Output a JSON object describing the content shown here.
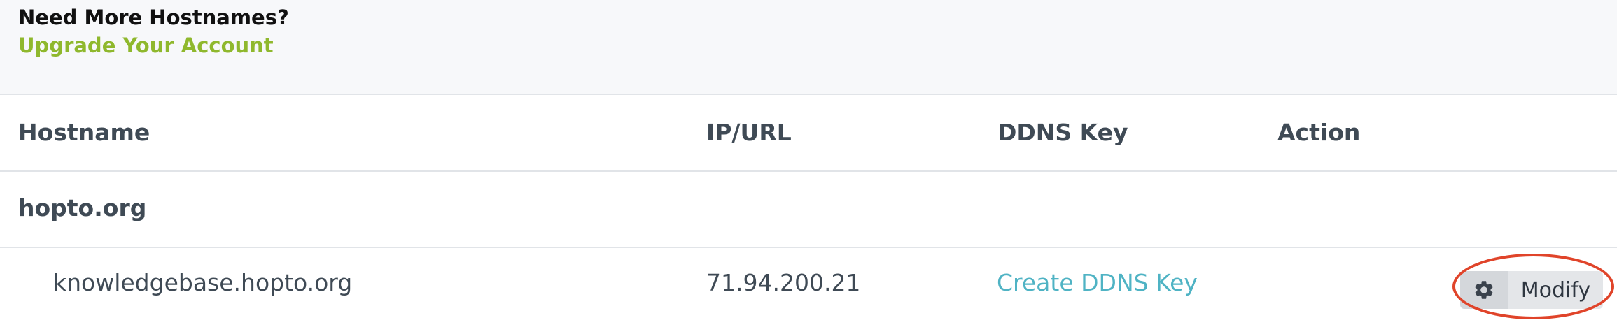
{
  "promo": {
    "title": "Need More Hostnames?",
    "link": "Upgrade Your Account"
  },
  "table": {
    "columns": [
      "Hostname",
      "IP/URL",
      "DDNS Key",
      "Action"
    ],
    "groups": [
      {
        "domain": "hopto.org",
        "rows": [
          {
            "hostname": "knowledgebase.hopto.org",
            "ip": "71.94.200.21",
            "ddns_key": "Create DDNS Key",
            "action_label": "Modify",
            "action_icon": "gear-icon"
          }
        ]
      }
    ]
  },
  "colors": {
    "accent_green": "#8fb82d",
    "link_teal": "#4fb3c4",
    "highlight_red": "#e0442a"
  }
}
